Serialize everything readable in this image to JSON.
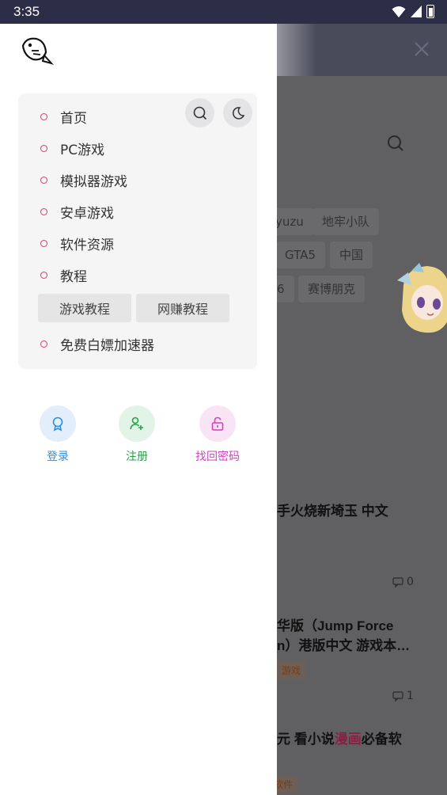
{
  "status_bar": {
    "time": "3:35"
  },
  "drawer": {
    "menu": [
      {
        "label": "首页"
      },
      {
        "label": "PC游戏"
      },
      {
        "label": "模拟器游戏"
      },
      {
        "label": "安卓游戏"
      },
      {
        "label": "软件资源"
      },
      {
        "label": "教程"
      }
    ],
    "sub_items": [
      {
        "label": "游戏教程"
      },
      {
        "label": "网赚教程"
      }
    ],
    "extra_item": {
      "label": "免费白嫖加速器"
    },
    "actions": [
      {
        "label": "登录",
        "color": "#2f8fde"
      },
      {
        "label": "注册",
        "color": "#27a24a"
      },
      {
        "label": "找回密码",
        "color": "#d63fc4"
      }
    ]
  },
  "background": {
    "tags": [
      "yuzu",
      "地牢小队",
      "GTA5",
      "中国",
      "6",
      "赛博朋克"
    ],
    "posts": [
      {
        "title": "手火烧新埼玉 中文",
        "comments": "0"
      },
      {
        "title_line1": "华版（Jump Force",
        "title_line2": "n）港版中文 游戏本…",
        "category": "游戏",
        "comments": "1"
      },
      {
        "title_prefix": "元 看小说",
        "title_highlight": "漫画",
        "title_suffix": "必备软",
        "category": "软件"
      }
    ]
  },
  "colors": {
    "bullet": "#e9346a",
    "status_bar": "#2c2e48"
  }
}
